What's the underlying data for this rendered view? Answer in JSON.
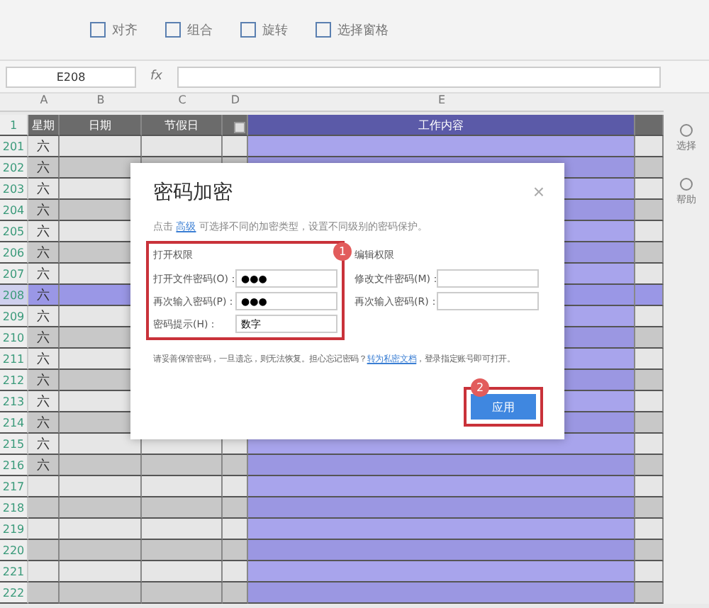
{
  "toolbar": {
    "buttons": [
      {
        "label": "对齐"
      },
      {
        "label": "组合"
      },
      {
        "label": "旋转"
      },
      {
        "label": "选择窗格"
      }
    ]
  },
  "formula_bar": {
    "cell_ref": "E208",
    "fx": "fx"
  },
  "sheet": {
    "columns": [
      "A",
      "B",
      "C",
      "D",
      "E"
    ],
    "header_row": "1",
    "header": [
      "星期",
      "日期",
      "节假日",
      "工作内容"
    ],
    "rows": [
      {
        "number": "201",
        "weekday": "六",
        "selected": false
      },
      {
        "number": "202",
        "weekday": "六",
        "selected": false
      },
      {
        "number": "203",
        "weekday": "六",
        "selected": false
      },
      {
        "number": "204",
        "weekday": "六",
        "selected": false
      },
      {
        "number": "205",
        "weekday": "六",
        "selected": false
      },
      {
        "number": "206",
        "weekday": "六",
        "selected": false
      },
      {
        "number": "207",
        "weekday": "六",
        "selected": false
      },
      {
        "number": "208",
        "weekday": "六",
        "selected": true
      },
      {
        "number": "209",
        "weekday": "六",
        "selected": false
      },
      {
        "number": "210",
        "weekday": "六",
        "selected": false
      },
      {
        "number": "211",
        "weekday": "六",
        "selected": false
      },
      {
        "number": "212",
        "weekday": "六",
        "selected": false
      },
      {
        "number": "213",
        "weekday": "六",
        "selected": false
      },
      {
        "number": "214",
        "weekday": "六",
        "selected": false
      },
      {
        "number": "215",
        "weekday": "六",
        "selected": false
      },
      {
        "number": "216",
        "weekday": "六",
        "selected": false
      },
      {
        "number": "217",
        "selected": false
      },
      {
        "number": "218",
        "selected": false
      },
      {
        "number": "219",
        "selected": false
      },
      {
        "number": "220",
        "selected": false
      },
      {
        "number": "221",
        "selected": false
      },
      {
        "number": "222",
        "selected": false
      }
    ]
  },
  "side_panel": {
    "items": [
      {
        "label": "选择"
      },
      {
        "label": "帮助"
      }
    ]
  },
  "dialog": {
    "title": "密码加密",
    "close": "×",
    "description": {
      "before": "点击 ",
      "link": "高级",
      "after": " 可选择不同的加密类型，设置不同级别的密码保护。"
    },
    "open_section": {
      "title": "打开权限",
      "fields": [
        {
          "label": "打开文件密码(O)：",
          "value": "●●●"
        },
        {
          "label": "再次输入密码(P)：",
          "value": "●●●"
        },
        {
          "label": "密码提示(H)：",
          "value": "数字"
        }
      ]
    },
    "edit_section": {
      "title": "编辑权限",
      "fields": [
        {
          "label": "修改文件密码(M)："
        },
        {
          "label": "再次输入密码(R)："
        }
      ]
    },
    "note": {
      "before": "请妥善保管密码，一旦遗忘，则无法恢复。担心忘记密码？",
      "link": "转为私密文档",
      "after": "，登录指定账号即可打开。"
    },
    "apply_button": "应用",
    "badges": [
      "1",
      "2"
    ]
  }
}
